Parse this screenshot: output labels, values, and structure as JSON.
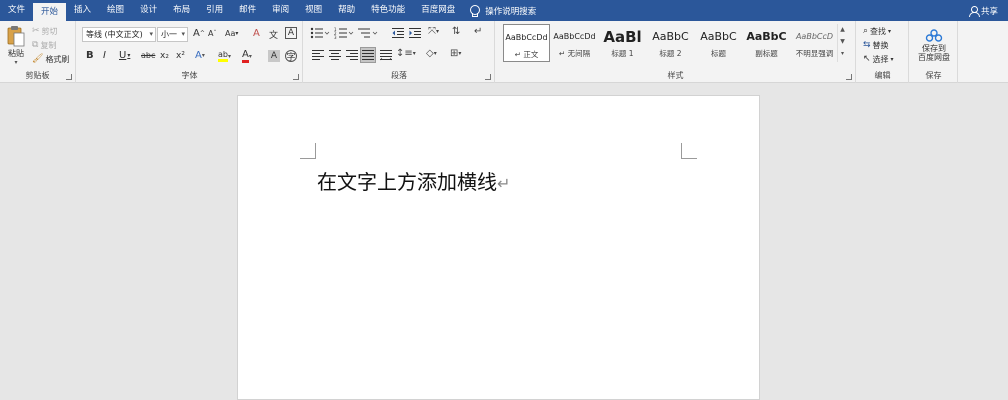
{
  "tabs": [
    "文件",
    "开始",
    "插入",
    "绘图",
    "设计",
    "布局",
    "引用",
    "邮件",
    "审阅",
    "视图",
    "帮助",
    "特色功能",
    "百度网盘"
  ],
  "active_tab": "开始",
  "tell_me": "操作说明搜索",
  "share": "共享",
  "clipboard": {
    "paste": "粘贴",
    "cut": "剪切",
    "copy": "复制",
    "format_painter": "格式刷",
    "label": "剪贴板"
  },
  "font": {
    "family": "等线 (中文正文)",
    "size": "小一",
    "label": "字体",
    "bold": "B",
    "italic": "I",
    "underline": "U",
    "strike": "abc",
    "subscript": "x₂",
    "superscript": "x²",
    "grow": "A",
    "shrink": "A",
    "case": "Aa",
    "clear": "A",
    "phonetic": "文",
    "border": "A",
    "effects": "A",
    "highlight": "ab",
    "color": "A",
    "shading": "A"
  },
  "paragraph": {
    "label": "段落"
  },
  "styles": {
    "label": "样式",
    "items": [
      {
        "sample": "AaBbCcDd",
        "name": "↵ 正文"
      },
      {
        "sample": "AaBbCcDd",
        "name": "↵ 无间隔"
      },
      {
        "sample": "AaBl",
        "name": "标题 1"
      },
      {
        "sample": "AaBbC",
        "name": "标题 2"
      },
      {
        "sample": "AaBbC",
        "name": "标题"
      },
      {
        "sample": "AaBbC",
        "name": "副标题"
      },
      {
        "sample": "AaBbCcD",
        "name": "不明显强调"
      }
    ]
  },
  "editing": {
    "label": "编辑",
    "find": "查找",
    "replace": "替换",
    "select": "选择"
  },
  "save": {
    "label": "保存",
    "button": "保存到\n百度网盘"
  },
  "document": {
    "text": "在文字上方添加横线",
    "para_mark": "↵"
  },
  "colors": {
    "ribbon_blue": "#2b579a",
    "highlight_yellow": "#ffff00",
    "font_red": "#e02020"
  }
}
